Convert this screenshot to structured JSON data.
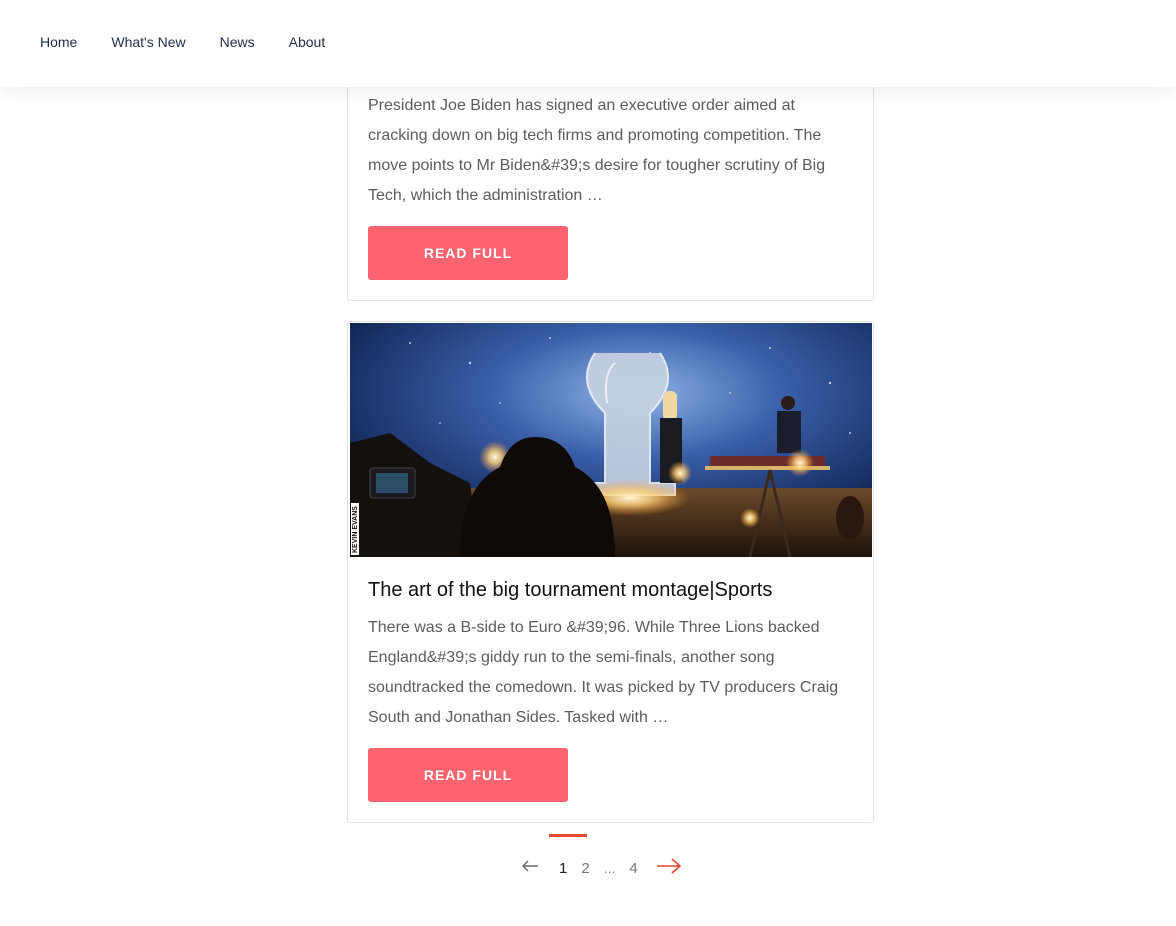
{
  "nav": {
    "items": [
      {
        "label": "Home"
      },
      {
        "label": "What's New"
      },
      {
        "label": "News"
      },
      {
        "label": "About"
      }
    ]
  },
  "articles": [
    {
      "excerpt": "President Joe Biden has signed an executive order aimed at cracking down on big tech firms and promoting competition. The move points to Mr Biden&#39;s desire for tougher scrutiny of Big Tech, which the administration …",
      "button_label": "READ FULL"
    },
    {
      "image_icon": "concert-stage-photo",
      "image_watermark": "KEVIN EVANS",
      "title": "The art of the big tournament montage|Sports",
      "excerpt": "There was a B-side to Euro &#39;96. While Three Lions backed England&#39;s giddy run to the semi-finals, another song soundtracked the comedown. It was picked by TV producers Craig South and Jonathan Sides. Tasked with …",
      "button_label": "READ FULL"
    }
  ],
  "pagination": {
    "pages": [
      "1",
      "2",
      "4"
    ],
    "ellipsis": "...",
    "current": "1",
    "accent_color": "#e8472f"
  },
  "colors": {
    "button": "#fe646f",
    "nav_text": "#1e2d4a"
  }
}
